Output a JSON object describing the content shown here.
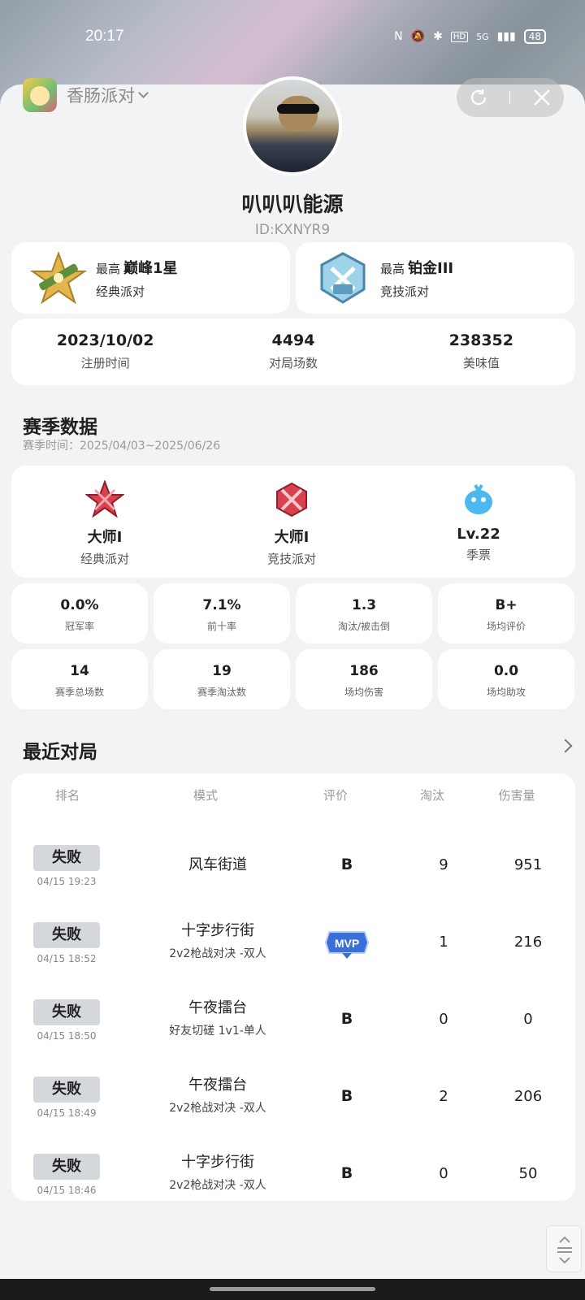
{
  "status_bar": {
    "time": "20:17",
    "network": "5G",
    "battery": "48"
  },
  "app": {
    "name": "香肠派对"
  },
  "profile": {
    "nickname": "叭叭叭能源",
    "id": "ID:KXNYR9"
  },
  "peak_ranks": [
    {
      "prefix": "最高",
      "rank": "巅峰1星",
      "mode": "经典派对"
    },
    {
      "prefix": "最高",
      "rank": "铂金III",
      "mode": "竞技派对"
    }
  ],
  "overview": [
    {
      "value": "2023/10/02",
      "label": "注册时间"
    },
    {
      "value": "4494",
      "label": "对局场数"
    },
    {
      "value": "238352",
      "label": "美味值"
    }
  ],
  "season": {
    "title": "赛季数据",
    "period": "赛季时间：2025/04/03~2025/06/26",
    "badges": [
      {
        "value": "大师I",
        "label": "经典派对",
        "icon": "master-rank-icon"
      },
      {
        "value": "大师I",
        "label": "竞技派对",
        "icon": "master-rank-icon"
      },
      {
        "value": "Lv.22",
        "label": "季票",
        "icon": "season-pass-icon"
      }
    ],
    "stats": [
      {
        "value": "0.0%",
        "label": "冠军率"
      },
      {
        "value": "7.1%",
        "label": "前十率"
      },
      {
        "value": "1.3",
        "label": "淘汰/被击倒"
      },
      {
        "value": "B+",
        "label": "场均评价"
      },
      {
        "value": "14",
        "label": "赛季总场数"
      },
      {
        "value": "19",
        "label": "赛季淘汰数"
      },
      {
        "value": "186",
        "label": "场均伤害"
      },
      {
        "value": "0.0",
        "label": "场均助攻"
      }
    ]
  },
  "recent": {
    "title": "最近对局",
    "headers": {
      "rank": "排名",
      "mode": "模式",
      "grade": "评价",
      "elim": "淘汰",
      "damage": "伤害量"
    },
    "rows": [
      {
        "result": "失败",
        "time": "04/15 19:23",
        "map": "风车街道",
        "sub": "",
        "grade": "B",
        "elim": "9",
        "damage": "951"
      },
      {
        "result": "失败",
        "time": "04/15 18:52",
        "map": "十字步行街",
        "sub": "2v2枪战对决 -双人",
        "grade": "MVP",
        "elim": "1",
        "damage": "216"
      },
      {
        "result": "失败",
        "time": "04/15 18:50",
        "map": "午夜擂台",
        "sub": "好友切磋 1v1-单人",
        "grade": "B",
        "elim": "0",
        "damage": "0"
      },
      {
        "result": "失败",
        "time": "04/15 18:49",
        "map": "午夜擂台",
        "sub": "2v2枪战对决 -双人",
        "grade": "B",
        "elim": "2",
        "damage": "206"
      },
      {
        "result": "失败",
        "time": "04/15 18:46",
        "map": "十字步行街",
        "sub": "2v2枪战对决 -双人",
        "grade": "B",
        "elim": "0",
        "damage": "50"
      }
    ]
  },
  "colors": {
    "accent_mvp": "#3b6fd8",
    "rank_red": "#d9414f",
    "pass_blue": "#4db8f0"
  }
}
